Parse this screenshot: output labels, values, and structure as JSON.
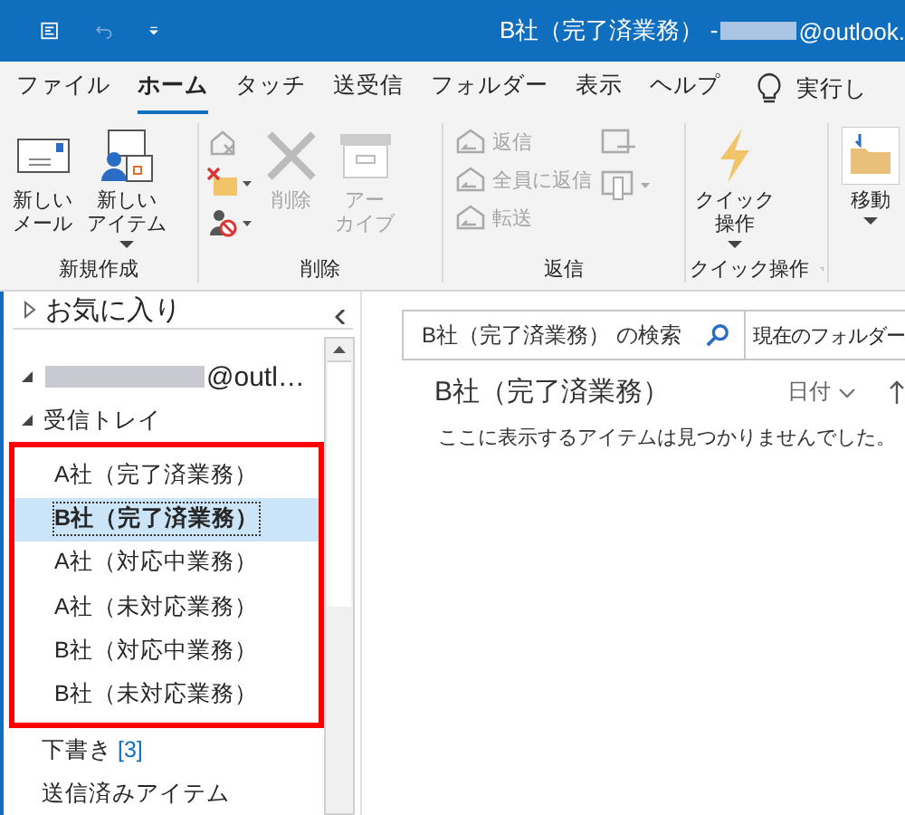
{
  "title_bar": {
    "title": "B社（完了済業務） - ",
    "account": "@outlook."
  },
  "menu_tabs": [
    {
      "label": "ファイル",
      "selected": false
    },
    {
      "label": "ホーム",
      "selected": true
    },
    {
      "label": "タッチ",
      "selected": false
    },
    {
      "label": "送受信",
      "selected": false
    },
    {
      "label": "フォルダー",
      "selected": false
    },
    {
      "label": "表示",
      "selected": false
    },
    {
      "label": "ヘルプ",
      "selected": false
    }
  ],
  "tell_me": "実行し",
  "ribbon": [
    {
      "label": "新規作成",
      "large": [
        {
          "lines": [
            "新しい",
            "メール"
          ],
          "disabled": false,
          "dropdown": false
        },
        {
          "lines": [
            "新しい",
            "アイテム"
          ],
          "disabled": false,
          "dropdown": true
        }
      ]
    },
    {
      "label": "削除",
      "large": [
        {
          "lines": [
            "削除"
          ],
          "disabled": true,
          "dropdown": false
        },
        {
          "lines": [
            "アー",
            "カイブ"
          ],
          "disabled": true,
          "dropdown": false
        }
      ]
    },
    {
      "label": "返信",
      "small": [
        {
          "label": "返信",
          "disabled": true
        },
        {
          "label": "全員に返信",
          "disabled": true
        },
        {
          "label": "転送",
          "disabled": true
        }
      ]
    },
    {
      "label": "クイック操作",
      "large": [
        {
          "lines": [
            "クイック",
            "操作"
          ],
          "disabled": false,
          "dropdown": true
        }
      ]
    },
    {
      "large": [
        {
          "lines": [
            "移動"
          ],
          "disabled": false,
          "dropdown": true
        }
      ]
    }
  ],
  "favorites": {
    "label": "お気に入り",
    "expanded": false
  },
  "folders": [
    {
      "label": "@outl…",
      "expanded": true,
      "children": [
        {
          "label": "受信トレイ",
          "expanded": true,
          "children": [
            {
              "label": "A社（完了済業務）",
              "selected": false
            },
            {
              "label": "B社（完了済業務）",
              "selected": true
            },
            {
              "label": "A社（対応中業務）",
              "selected": false
            },
            {
              "label": "A社（未対応業務）",
              "selected": false
            },
            {
              "label": "B社（対応中業務）",
              "selected": false
            },
            {
              "label": "B社（未対応業務）",
              "selected": false
            }
          ]
        },
        {
          "label": "下書き",
          "count": "[3]"
        },
        {
          "label": "送信済みアイテム"
        }
      ]
    }
  ],
  "search": {
    "placeholder": "B社（完了済業務） の検索",
    "scope": "現在のフォルダー"
  },
  "message_list": {
    "folder": "B社（完了済業務）",
    "sort": "日付",
    "empty_text": "ここに表示するアイテムは見つかりませんでした。"
  }
}
